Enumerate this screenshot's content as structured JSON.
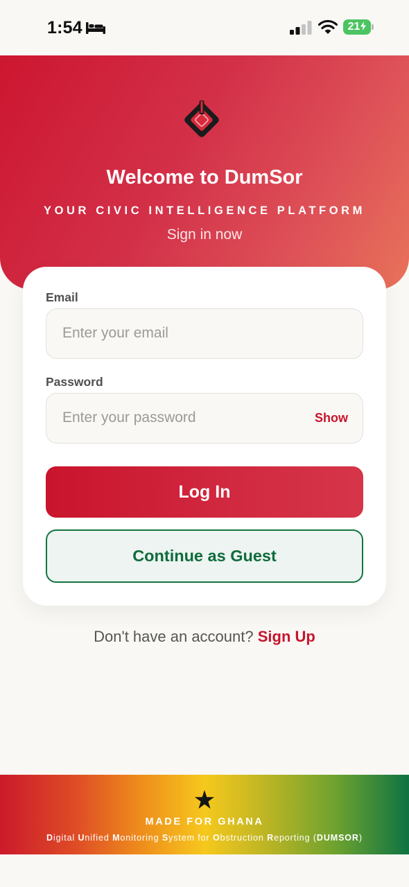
{
  "status_bar": {
    "time": "1:54",
    "battery": "21",
    "icons": [
      "bed-icon",
      "signal-icon",
      "wifi-icon",
      "battery-charging-icon"
    ]
  },
  "header": {
    "logo_icon": "dumsor-diamond-logo-icon",
    "title": "Welcome to DumSor",
    "tagline": "YOUR CIVIC INTELLIGENCE PLATFORM",
    "subtitle": "Sign in now",
    "gradient_colors": [
      "#cd1630",
      "#e8735a"
    ]
  },
  "form": {
    "email_label": "Email",
    "email_placeholder": "Enter your email",
    "email_value": "",
    "password_label": "Password",
    "password_placeholder": "Enter your password",
    "password_value": "",
    "show_label": "Show",
    "login_label": "Log In",
    "guest_label": "Continue as Guest"
  },
  "signup": {
    "prompt": "Don't have an account?",
    "link_label": "Sign Up"
  },
  "footer": {
    "star_icon": "black-star-icon",
    "made_for": "MADE FOR GHANA",
    "acronym_parts": [
      {
        "initial": "D",
        "rest": "igital "
      },
      {
        "initial": "U",
        "rest": "nified "
      },
      {
        "initial": "M",
        "rest": "onitoring "
      },
      {
        "initial": "S",
        "rest": "ystem for "
      },
      {
        "initial": "O",
        "rest": "bstruction "
      },
      {
        "initial": "R",
        "rest": "eporting ("
      }
    ],
    "acronym_name": "DUMSOR",
    "acronym_close": ")"
  },
  "colors": {
    "brand_red": "#c8142e",
    "guest_green": "#137441",
    "background": "#f9f8f4"
  }
}
